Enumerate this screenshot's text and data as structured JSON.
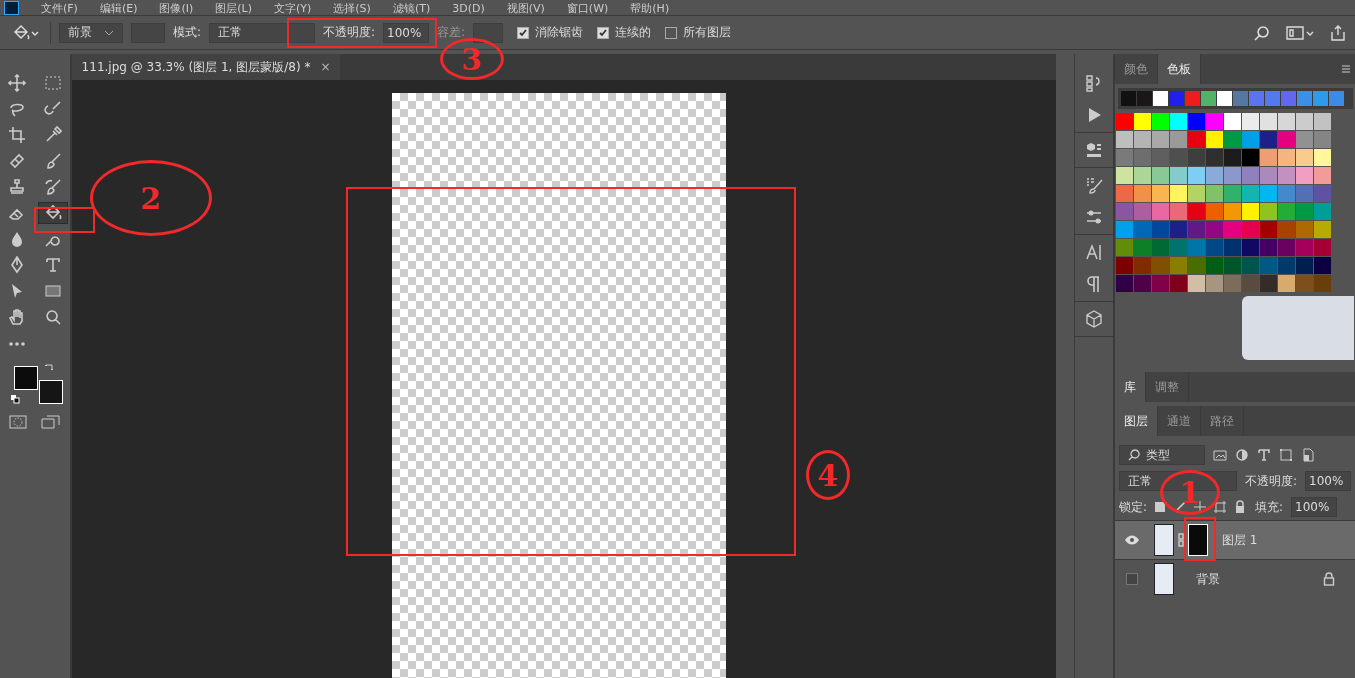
{
  "menu": [
    "文件(F)",
    "编辑(E)",
    "图像(I)",
    "图层(L)",
    "文字(Y)",
    "选择(S)",
    "滤镜(T)",
    "3D(D)",
    "视图(V)",
    "窗口(W)",
    "帮助(H)"
  ],
  "options_bar": {
    "fill_source": "前景",
    "mode_label": "模式:",
    "mode": "正常",
    "opacity_label": "不透明度:",
    "opacity": "100%",
    "tolerance_label": "容差:",
    "checkboxes": [
      {
        "label": "消除锯齿",
        "checked": true
      },
      {
        "label": "连续的",
        "checked": true
      },
      {
        "label": "所有图层",
        "checked": false
      }
    ]
  },
  "document_tab": {
    "title": "111.jpg @ 33.3% (图层 1, 图层蒙版/8) *",
    "close": "×"
  },
  "tools": [
    {
      "kind": "move",
      "selected": false
    },
    {
      "kind": "marquee",
      "selected": false
    },
    {
      "kind": "lasso",
      "selected": false
    },
    {
      "kind": "quick-select",
      "selected": false
    },
    {
      "kind": "crop",
      "selected": false
    },
    {
      "kind": "eyedropper",
      "selected": false
    },
    {
      "kind": "healing",
      "selected": false
    },
    {
      "kind": "brush",
      "selected": false
    },
    {
      "kind": "stamp",
      "selected": false
    },
    {
      "kind": "history-brush",
      "selected": false
    },
    {
      "kind": "eraser",
      "selected": false
    },
    {
      "kind": "bucket",
      "selected": true
    },
    {
      "kind": "blur",
      "selected": false
    },
    {
      "kind": "dodge",
      "selected": false
    },
    {
      "kind": "pen",
      "selected": false
    },
    {
      "kind": "type",
      "selected": false
    },
    {
      "kind": "path-select",
      "selected": false
    },
    {
      "kind": "shape",
      "selected": false
    },
    {
      "kind": "hand",
      "selected": false
    },
    {
      "kind": "zoom",
      "selected": false
    },
    {
      "kind": "more",
      "selected": false
    }
  ],
  "swatch_panel": {
    "tabs": [
      {
        "label": "颜色",
        "selected": false
      },
      {
        "label": "色板",
        "selected": true
      }
    ],
    "recent": [
      {
        "color": "#111111"
      },
      {
        "color": "#1a1716"
      },
      {
        "color": "#ffffff"
      },
      {
        "color": "#2020ee"
      },
      {
        "color": "#ee1c1c"
      },
      {
        "color": "#4fb36a"
      },
      {
        "color": "#ffffff"
      },
      {
        "color": "#5577a0"
      },
      {
        "color": "#5b73ee"
      },
      {
        "color": "#5479ee"
      },
      {
        "color": "#6268ee"
      },
      {
        "color": "#3a8fe6"
      },
      {
        "color": "#2e9aea"
      },
      {
        "color": "#3a8ce6"
      }
    ],
    "swatches": [
      {
        "color": "#ff0000"
      },
      {
        "color": "#ffff00"
      },
      {
        "color": "#00ff00"
      },
      {
        "color": "#00ffff"
      },
      {
        "color": "#0000ff"
      },
      {
        "color": "#ff00ff"
      },
      {
        "color": "#ffffff"
      },
      {
        "color": "#ebebeb"
      },
      {
        "color": "#e1e1e1"
      },
      {
        "color": "#d7d7d7"
      },
      {
        "color": "#cccccc"
      },
      {
        "color": "#c2c2c2"
      },
      {
        "color": "#bebebe"
      },
      {
        "color": "#b4b4b4"
      },
      {
        "color": "#a9a9a9"
      },
      {
        "color": "#9a9a9a"
      },
      {
        "color": "#e60012"
      },
      {
        "color": "#fff100"
      },
      {
        "color": "#009944"
      },
      {
        "color": "#00a0e9"
      },
      {
        "color": "#1d2088"
      },
      {
        "color": "#e4007f"
      },
      {
        "color": "#919191"
      },
      {
        "color": "#858585"
      },
      {
        "color": "#7a7a7a"
      },
      {
        "color": "#6e6e6e"
      },
      {
        "color": "#5f5f5f"
      },
      {
        "color": "#4f4f4f"
      },
      {
        "color": "#3e3e3e"
      },
      {
        "color": "#2f2f2f"
      },
      {
        "color": "#1c1c1c"
      },
      {
        "color": "#000000"
      },
      {
        "color": "#f19d74"
      },
      {
        "color": "#f5b482"
      },
      {
        "color": "#f8cd8c"
      },
      {
        "color": "#fff799"
      },
      {
        "color": "#cee3a0"
      },
      {
        "color": "#acd598"
      },
      {
        "color": "#89c997"
      },
      {
        "color": "#84ccc9"
      },
      {
        "color": "#7ecef4"
      },
      {
        "color": "#89abda"
      },
      {
        "color": "#8c97cb"
      },
      {
        "color": "#8f82bc"
      },
      {
        "color": "#aa89bd"
      },
      {
        "color": "#c490bf"
      },
      {
        "color": "#f19ec2"
      },
      {
        "color": "#f29b9b"
      },
      {
        "color": "#eb6946"
      },
      {
        "color": "#f19149"
      },
      {
        "color": "#f8b551"
      },
      {
        "color": "#fff45c"
      },
      {
        "color": "#b3d465"
      },
      {
        "color": "#80c269"
      },
      {
        "color": "#32b16c"
      },
      {
        "color": "#13b5b1"
      },
      {
        "color": "#00b7ee"
      },
      {
        "color": "#448aca"
      },
      {
        "color": "#556fb5"
      },
      {
        "color": "#5f52a0"
      },
      {
        "color": "#8957a1"
      },
      {
        "color": "#ae5da1"
      },
      {
        "color": "#ea68a2"
      },
      {
        "color": "#eb6877"
      },
      {
        "color": "#e60013"
      },
      {
        "color": "#eb6100"
      },
      {
        "color": "#f39800"
      },
      {
        "color": "#fff101"
      },
      {
        "color": "#8fc31f"
      },
      {
        "color": "#22ac38"
      },
      {
        "color": "#009945"
      },
      {
        "color": "#009e96"
      },
      {
        "color": "#00a0ea"
      },
      {
        "color": "#0068b7"
      },
      {
        "color": "#00479d"
      },
      {
        "color": "#1d2089"
      },
      {
        "color": "#601986"
      },
      {
        "color": "#920783"
      },
      {
        "color": "#e40080"
      },
      {
        "color": "#e5004f"
      },
      {
        "color": "#a40000"
      },
      {
        "color": "#a84200"
      },
      {
        "color": "#ac6a00"
      },
      {
        "color": "#b7aa00"
      },
      {
        "color": "#638c0b"
      },
      {
        "color": "#0e7f26"
      },
      {
        "color": "#006934"
      },
      {
        "color": "#00736d"
      },
      {
        "color": "#0075a9"
      },
      {
        "color": "#004986"
      },
      {
        "color": "#013171"
      },
      {
        "color": "#100964"
      },
      {
        "color": "#440062"
      },
      {
        "color": "#6a005f"
      },
      {
        "color": "#a4005b"
      },
      {
        "color": "#a40035"
      },
      {
        "color": "#7d0000"
      },
      {
        "color": "#7f2d00"
      },
      {
        "color": "#814f00"
      },
      {
        "color": "#8a7e00"
      },
      {
        "color": "#496d01"
      },
      {
        "color": "#005e15"
      },
      {
        "color": "#00552b"
      },
      {
        "color": "#005450"
      },
      {
        "color": "#005982"
      },
      {
        "color": "#003a6b"
      },
      {
        "color": "#001e50"
      },
      {
        "color": "#0b0042"
      },
      {
        "color": "#300047"
      },
      {
        "color": "#500046"
      },
      {
        "color": "#82004a"
      },
      {
        "color": "#80001c"
      },
      {
        "color": "#d0bfa4"
      },
      {
        "color": "#a69580"
      },
      {
        "color": "#7d6c5c"
      },
      {
        "color": "#594b40"
      },
      {
        "color": "#352b28"
      },
      {
        "color": "#d7aa6e"
      },
      {
        "color": "#7d4f1c"
      },
      {
        "color": "#6b3d0a"
      }
    ]
  },
  "library_tabs": [
    {
      "label": "库",
      "selected": true
    },
    {
      "label": "调整",
      "selected": false
    }
  ],
  "layers_panel": {
    "tabs": [
      {
        "label": "图层",
        "selected": true
      },
      {
        "label": "通道",
        "selected": false
      },
      {
        "label": "路径",
        "selected": false
      }
    ],
    "filter": "类型",
    "blend_mode": "正常",
    "opacity_label": "不透明度:",
    "opacity": "100%",
    "lock_label": "锁定:",
    "fill_label": "填充:",
    "fill": "100%",
    "layers": [
      {
        "name": "图层 1",
        "visible": true,
        "selected": true,
        "mask": true,
        "locked": false
      },
      {
        "name": "背景",
        "visible": false,
        "selected": false,
        "mask": false,
        "locked": true
      }
    ]
  },
  "annotations": [
    {
      "label": "2"
    },
    {
      "label": "3"
    },
    {
      "label": "4"
    },
    {
      "label": "1"
    }
  ]
}
